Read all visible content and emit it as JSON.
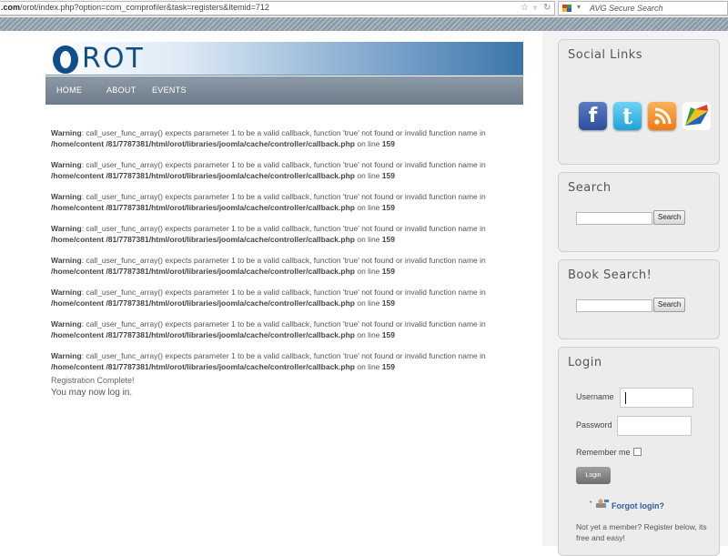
{
  "browser": {
    "url_prefix": ".com",
    "url_rest": "/orot/index.php?option=com_comprofiler&task=registers&Itemid=712",
    "search_placeholder": "AVG Secure Search"
  },
  "site": {
    "logo_text": "ROT",
    "nav": [
      "HOME",
      "ABOUT",
      "EVENTS"
    ]
  },
  "warnings": [
    {
      "label": "Warning",
      "message": ": call_user_func_array() expects parameter 1 to be a valid callback, function 'true' not found or invalid function name in ",
      "path": "/home/content /81/7787381/html/orot/libraries/joomla/cache/controller/callback.php",
      "online": " on line ",
      "line": "159"
    },
    {
      "label": "Warning",
      "message": ": call_user_func_array() expects parameter 1 to be a valid callback, function 'true' not found or invalid function name in ",
      "path": "/home/content /81/7787381/html/orot/libraries/joomla/cache/controller/callback.php",
      "online": " on line ",
      "line": "159"
    },
    {
      "label": "Warning",
      "message": ": call_user_func_array() expects parameter 1 to be a valid callback, function 'true' not found or invalid function name in ",
      "path": "/home/content /81/7787381/html/orot/libraries/joomla/cache/controller/callback.php",
      "online": " on line ",
      "line": "159"
    },
    {
      "label": "Warning",
      "message": ": call_user_func_array() expects parameter 1 to be a valid callback, function 'true' not found or invalid function name in ",
      "path": "/home/content /81/7787381/html/orot/libraries/joomla/cache/controller/callback.php",
      "online": " on line ",
      "line": "159"
    },
    {
      "label": "Warning",
      "message": ": call_user_func_array() expects parameter 1 to be a valid callback, function 'true' not found or invalid function name in ",
      "path": "/home/content /81/7787381/html/orot/libraries/joomla/cache/controller/callback.php",
      "online": " on line ",
      "line": "159"
    },
    {
      "label": "Warning",
      "message": ": call_user_func_array() expects parameter 1 to be a valid callback, function 'true' not found or invalid function name in ",
      "path": "/home/content /81/7787381/html/orot/libraries/joomla/cache/controller/callback.php",
      "online": " on line ",
      "line": "159"
    },
    {
      "label": "Warning",
      "message": ": call_user_func_array() expects parameter 1 to be a valid callback, function 'true' not found or invalid function name in ",
      "path": "/home/content /81/7787381/html/orot/libraries/joomla/cache/controller/callback.php",
      "online": " on line ",
      "line": "159"
    },
    {
      "label": "Warning",
      "message": ": call_user_func_array() expects parameter 1 to be a valid callback, function 'true' not found or invalid function name in ",
      "path": "/home/content /81/7787381/html/orot/libraries/joomla/cache/controller/callback.php",
      "online": " on line ",
      "line": "159"
    }
  ],
  "registration_complete": "Registration Complete!",
  "may_log_in": "You may now log in.",
  "sidebar": {
    "social_title": "Social Links",
    "social_icons": [
      {
        "name": "facebook-icon",
        "glyph": "f"
      },
      {
        "name": "twitter-icon",
        "glyph": "t"
      },
      {
        "name": "rss-icon",
        "glyph": ""
      },
      {
        "name": "google-buzz-icon",
        "glyph": ""
      }
    ],
    "search_title": "Search",
    "search_button": "Search",
    "book_search_title": "Book Search!",
    "book_search_button": "Search",
    "login_title": "Login",
    "username_label": "Username",
    "password_label": "Password",
    "remember_label": "Remember me",
    "login_button": "Login",
    "forgot_link": "Forgot login?",
    "not_member": "Not yet a member? Register below, its free and easy!"
  },
  "colors": {
    "brand_blue": "#0e4f8a",
    "nav_gray": "#7a8896",
    "link_blue": "#2d5d9a"
  }
}
